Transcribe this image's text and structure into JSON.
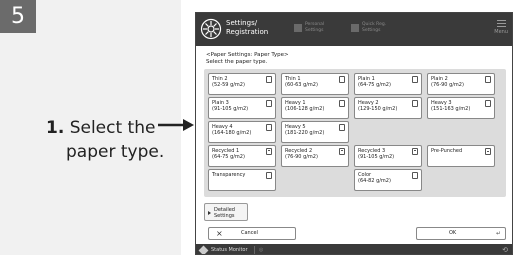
{
  "step": {
    "number": "5"
  },
  "instruction": {
    "number": "1.",
    "line1": "Select the",
    "line2": "paper type."
  },
  "topbar": {
    "title_line1": "Settings/",
    "title_line2": "Registration",
    "tab2_line1": "Personal",
    "tab2_line2": "Settings",
    "tab3_line1": "Quick Reg.",
    "tab3_line2": "Settings",
    "menu_label": "Menu"
  },
  "heading": {
    "line1": "<Paper Settings: Paper Type>",
    "line2": "Select the paper type."
  },
  "paper_types": [
    {
      "name": "Thin 2",
      "weight": "(52-59 g/m2)",
      "icon": "paper-icon"
    },
    {
      "name": "Thin 1",
      "weight": "(60-63 g/m2)",
      "icon": "paper-icon"
    },
    {
      "name": "Plain 1",
      "weight": "(64-75 g/m2)",
      "icon": "paper-icon"
    },
    {
      "name": "Plain 2",
      "weight": "(76-90 g/m2)",
      "icon": "paper-icon"
    },
    {
      "name": "Plain 3",
      "weight": "(91-105 g/m2)",
      "icon": "paper-icon"
    },
    {
      "name": "Heavy 1",
      "weight": "(106-128 g/m2)",
      "icon": "paper-icon"
    },
    {
      "name": "Heavy 2",
      "weight": "(129-150 g/m2)",
      "icon": "paper-icon"
    },
    {
      "name": "Heavy 3",
      "weight": "(151-163 g/m2)",
      "icon": "paper-icon"
    },
    {
      "name": "Heavy 4",
      "weight": "(164-180 g/m2)",
      "icon": "paper-icon"
    },
    {
      "name": "Heavy 5",
      "weight": "(181-220 g/m2)",
      "icon": "paper-icon"
    },
    {
      "name": "Recycled 1",
      "weight": "(64-75 g/m2)",
      "icon": "recycled-paper-icon"
    },
    {
      "name": "Recycled 2",
      "weight": "(76-90 g/m2)",
      "icon": "recycled-paper-icon"
    },
    {
      "name": "Recycled 3",
      "weight": "(91-105 g/m2)",
      "icon": "recycled-paper-icon"
    },
    {
      "name": "Pre-Punched",
      "weight": "",
      "icon": "punched-paper-icon"
    },
    {
      "name": "Transparency",
      "weight": "",
      "icon": "transparency-icon"
    },
    {
      "name": "Color",
      "weight": "(64-82 g/m2)",
      "icon": "paper-icon"
    }
  ],
  "buttons": {
    "detailed_line1": "Detailed",
    "detailed_line2": "Settings",
    "cancel": "Cancel",
    "ok": "OK"
  },
  "statusbar": {
    "label": "Status Monitor"
  },
  "colors": {
    "topbar": "#3a3a3a",
    "panel": "#dcdcdc",
    "step_badge": "#6b6b6b",
    "sidebar": "#f1f1f1"
  }
}
